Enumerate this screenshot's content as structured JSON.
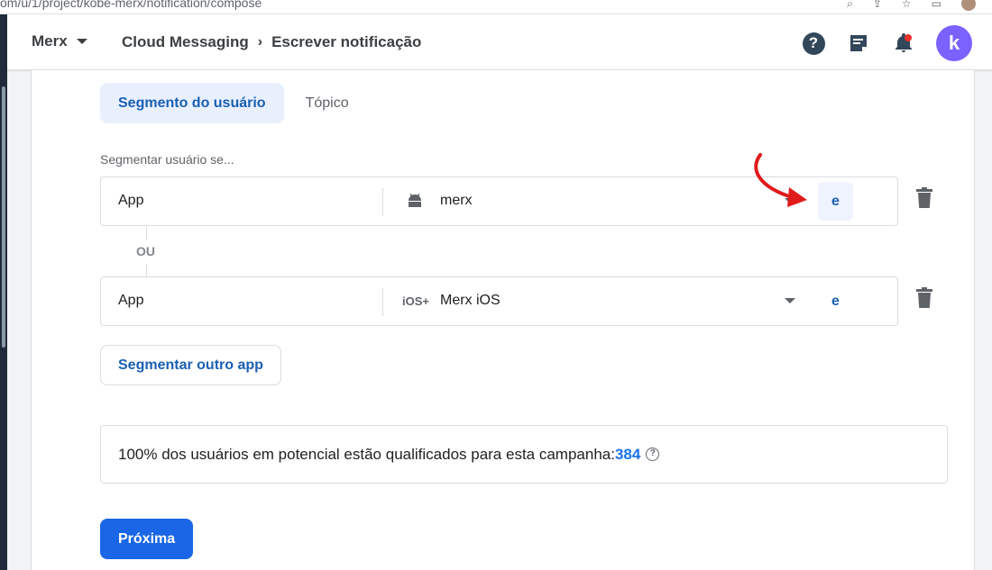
{
  "browser": {
    "url": "om/u/1/project/kobe-merx/notification/compose"
  },
  "header": {
    "project_name": "Merx",
    "breadcrumb": [
      "Cloud Messaging",
      "Escrever notificação"
    ],
    "breadcrumb_separator": "›",
    "help_icon": "?",
    "avatar_letter": "k",
    "icons": [
      "help-icon",
      "feedback-icon",
      "notifications-icon",
      "avatar"
    ]
  },
  "targeting": {
    "tabs": [
      {
        "label": "Segmento do usuário",
        "active": true
      },
      {
        "label": "Tópico",
        "active": false
      }
    ],
    "section_label": "Segmentar usuário se...",
    "rows": [
      {
        "left": "App",
        "platform": "android-icon",
        "app": "merx",
        "and_label": "e"
      },
      {
        "left": "App",
        "platform": "ios-icon",
        "platform_text": "iOS+",
        "app": "Merx iOS",
        "and_label": "e"
      }
    ],
    "or_label": "OU",
    "add_app_button": "Segmentar outro app"
  },
  "summary": {
    "text": "100% dos usuários em potencial estão qualificados para esta campanha:",
    "count": "384",
    "help": "?"
  },
  "actions": {
    "next_button": "Próxima"
  },
  "colors": {
    "accent": "#1a66e6",
    "link": "#1a5fb4",
    "annotation": "#e01b1b"
  }
}
